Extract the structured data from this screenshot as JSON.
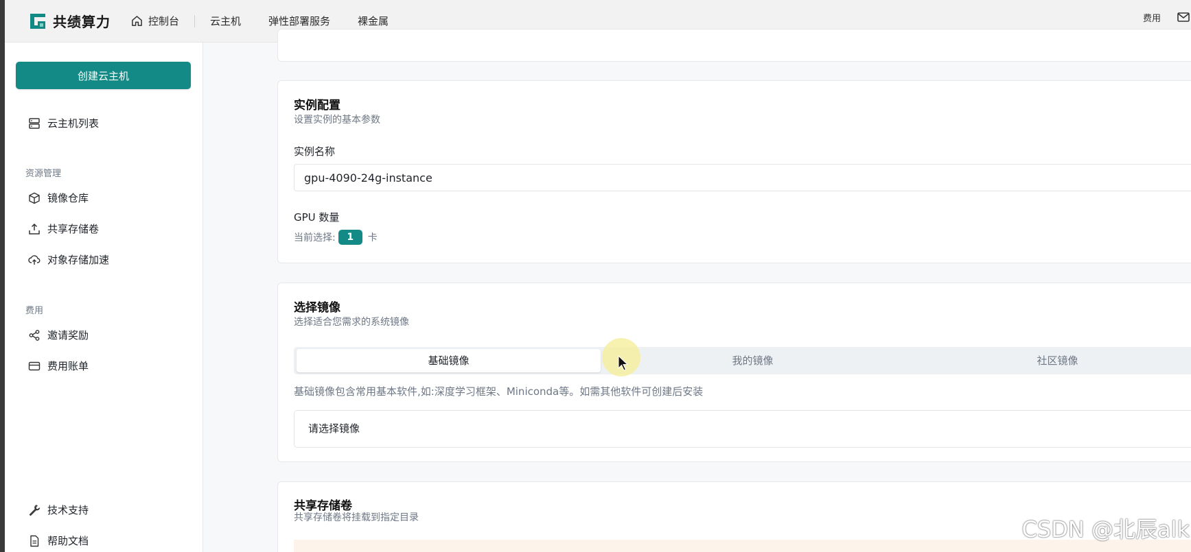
{
  "brand": {
    "name": "共绩算力",
    "accent": "#138a86"
  },
  "topnav": {
    "home": "控制台",
    "items": [
      "云主机",
      "弹性部署服务",
      "裸金属"
    ],
    "right_link": "费用"
  },
  "sidebar": {
    "create_button": "创建云主机",
    "instance_list": "云主机列表",
    "resource_group": "资源管理",
    "resource_items": [
      "镜像仓库",
      "共享存储卷",
      "对象存储加速"
    ],
    "billing_group": "费用",
    "billing_items": [
      "邀请奖励",
      "费用账单"
    ],
    "support": "技术支持",
    "docs": "帮助文档"
  },
  "instance_config": {
    "title": "实例配置",
    "subtitle": "设置实例的基本参数",
    "name_label": "实例名称",
    "name_value": "gpu-4090-24g-instance",
    "gpu_label": "GPU 数量",
    "gpu_current_prefix": "当前选择:",
    "gpu_count": "1",
    "gpu_unit": "卡"
  },
  "image_select": {
    "title": "选择镜像",
    "subtitle": "选择适合您需求的系统镜像",
    "tabs": [
      "基础镜像",
      "我的镜像",
      "社区镜像"
    ],
    "active_tab": "基础镜像",
    "hint": "基础镜像包含常用基本软件,如:深度学习框架、Miniconda等。如需其他软件可创建后安装",
    "placeholder": "请选择镜像"
  },
  "shared_storage": {
    "title": "共享存储卷",
    "subtitle": "共享存储卷将挂载到指定目录"
  },
  "watermark": "CSDN @北辰alk"
}
